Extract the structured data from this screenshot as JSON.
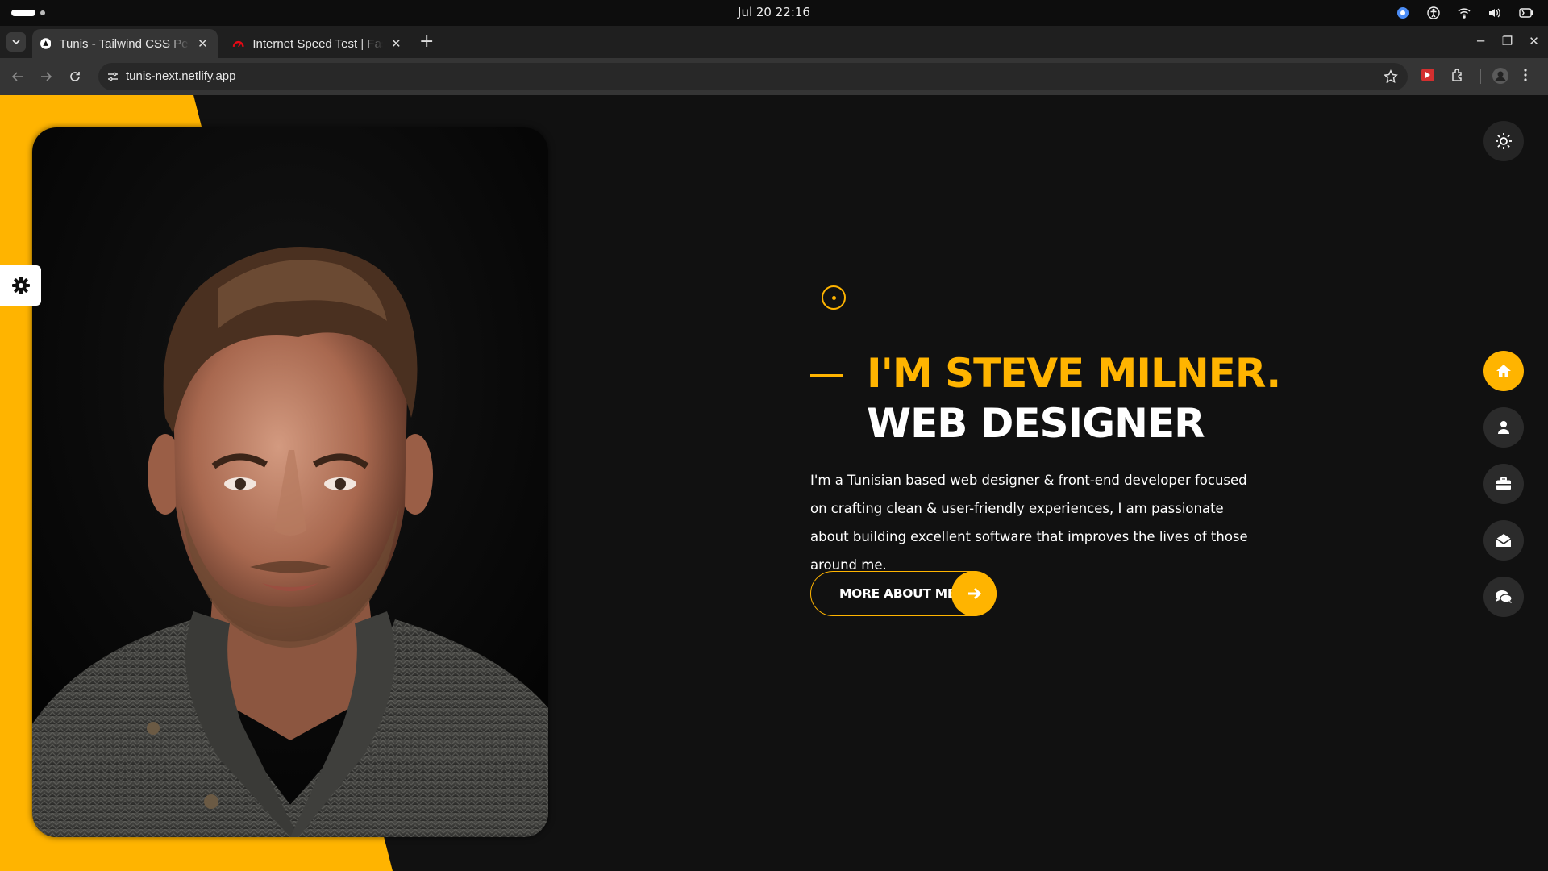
{
  "os": {
    "clock": "Jul 20  22:16"
  },
  "browser": {
    "tabs": [
      {
        "title": "Tunis - Tailwind CSS Personal Portfolio",
        "active": true
      },
      {
        "title": "Internet Speed Test | Fast.com",
        "active": false
      }
    ],
    "url": "tunis-next.netlify.app"
  },
  "colors": {
    "accent": "#ffb400",
    "page_bg": "#111111",
    "nav_bg": "#2b2b2b"
  },
  "hero": {
    "greeting": "I'M STEVE MILNER.",
    "role": "WEB DESIGNER",
    "description": "I'm a Tunisian based web designer & front-end developer focused on crafting clean & user-friendly experiences, I am passionate about building excellent software that improves the lives of those around me.",
    "cta_label": "MORE ABOUT ME"
  },
  "side_nav": {
    "items": [
      {
        "icon": "home-icon",
        "active": true
      },
      {
        "icon": "user-icon",
        "active": false
      },
      {
        "icon": "briefcase-icon",
        "active": false
      },
      {
        "icon": "envelope-open-icon",
        "active": false
      },
      {
        "icon": "comments-icon",
        "active": false
      }
    ]
  }
}
